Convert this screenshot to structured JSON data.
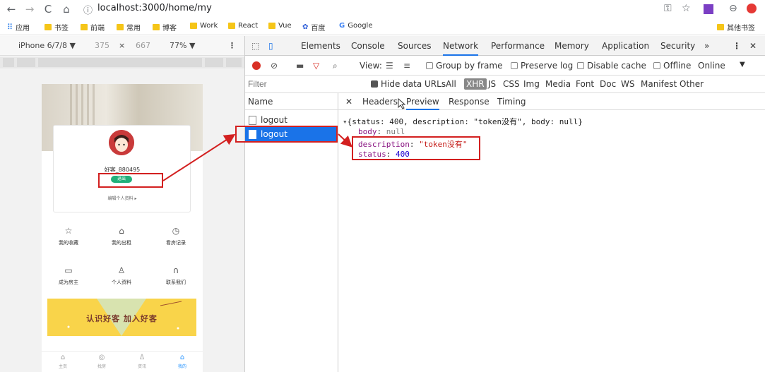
{
  "browser": {
    "url": "localhost:3000/home/my",
    "bookmarks": [
      {
        "label": "应用",
        "icon": "apps-grid-icon"
      },
      {
        "label": "书签"
      },
      {
        "label": "前端"
      },
      {
        "label": "常用"
      },
      {
        "label": "博客"
      },
      {
        "label": "Work"
      },
      {
        "label": "React"
      },
      {
        "label": "Vue"
      },
      {
        "label": "百度",
        "icon": "paw-icon"
      },
      {
        "label": "Google",
        "icon": "google-g-icon"
      }
    ],
    "other_bookmarks": "其他书签"
  },
  "device": {
    "name": "iPhone 6/7/8 ▼",
    "width": "375",
    "x": "×",
    "height": "667",
    "zoom": "77% ▼"
  },
  "app": {
    "username": "好客_880495",
    "logout_label": "退出",
    "edit_profile": "编辑个人资料 ▸",
    "grid": [
      {
        "label": "我的收藏",
        "icon": "star-icon",
        "glyph": "☆"
      },
      {
        "label": "我的出租",
        "icon": "home-icon",
        "glyph": "⌂"
      },
      {
        "label": "看房记录",
        "icon": "clock-icon",
        "glyph": "◷"
      },
      {
        "label": "成为房主",
        "icon": "card-icon",
        "glyph": "▭"
      },
      {
        "label": "个人资料",
        "icon": "person-icon",
        "glyph": "♙"
      },
      {
        "label": "联系我们",
        "icon": "headset-icon",
        "glyph": "∩"
      }
    ],
    "join_banner": "认识好客 加入好客",
    "tabs": [
      {
        "label": "主页",
        "icon": "home-tab-icon",
        "glyph": "⌂"
      },
      {
        "label": "找房",
        "icon": "search-tab-icon",
        "glyph": "◎"
      },
      {
        "label": "资讯",
        "icon": "news-tab-icon",
        "glyph": "♙"
      },
      {
        "label": "我的",
        "icon": "my-tab-icon",
        "glyph": "⌂"
      }
    ]
  },
  "devtools": {
    "tabs": [
      "Elements",
      "Console",
      "Sources",
      "Network",
      "Performance",
      "Memory",
      "Application",
      "Security"
    ],
    "active_tab": "Network",
    "more": "»",
    "network": {
      "view": "View:",
      "group_by_frame": "Group by frame",
      "preserve_log": "Preserve log",
      "disable_cache": "Disable cache",
      "offline": "Offline",
      "throttle": "Online",
      "filter_placeholder": "Filter",
      "hide_data_urls": "Hide data URLs",
      "filter_types": [
        "All",
        "XHR",
        "JS",
        "CSS",
        "Img",
        "Media",
        "Font",
        "Doc",
        "WS",
        "Manifest",
        "Other"
      ]
    },
    "name_header": "Name",
    "requests": [
      "logout",
      "logout"
    ],
    "detail_tabs": [
      "Headers",
      "Preview",
      "Response",
      "Timing"
    ],
    "active_detail_tab": "Preview",
    "preview": {
      "summary": "{status: 400, description: \"token没有\", body: null}",
      "body_key": "body",
      "body_val": "null",
      "desc_key": "description",
      "desc_val": "\"token没有\"",
      "status_key": "status",
      "status_val": "400"
    }
  },
  "colors": {
    "accent": "#1a73e8",
    "annotation": "#d32020",
    "logout_green": "#21b07a",
    "banner_yellow": "#f9d44a"
  }
}
